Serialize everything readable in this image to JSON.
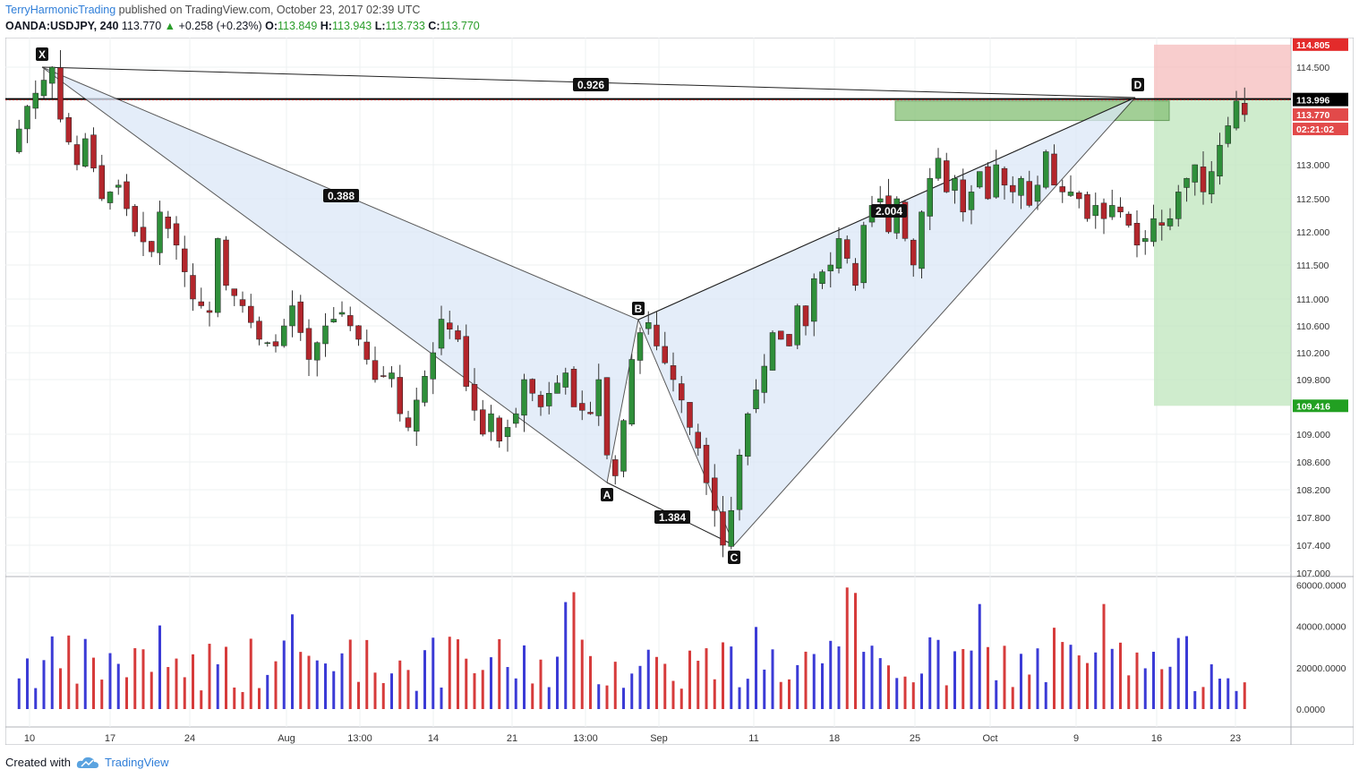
{
  "header": {
    "author": "TerryHarmonicTrading",
    "published_text": " published on TradingView.com, October 23, 2017 02:39 UTC",
    "symbol": "OANDA:USDJPY, 240",
    "last": "113.770",
    "change": "+0.258 (+0.23%)",
    "o_label": "O:",
    "o": "113.849",
    "h_label": "H:",
    "h": "113.943",
    "l_label": "L:",
    "l": "113.733",
    "c_label": "C:",
    "c": "113.770"
  },
  "footer": {
    "created_with": "Created with",
    "brand": "TradingView"
  },
  "colors": {
    "bull": "#2f8f3a",
    "bear": "#b3262c",
    "pattern_fill": "#dbe7f7",
    "stop_zone": "#f5b8b8",
    "target_zone": "#bfe6bc",
    "prz_box": "#8bc47d",
    "vol_up": "#3b3bd6",
    "vol_down": "#d63b3b"
  },
  "chart_data": {
    "type": "candlestick",
    "ylim": [
      106.9,
      114.9
    ],
    "price_ticks": [
      "114.500",
      "113.000",
      "112.500",
      "112.000",
      "111.500",
      "111.000",
      "110.600",
      "110.200",
      "109.800",
      "109.000",
      "108.600",
      "108.200",
      "107.800",
      "107.400",
      "107.000"
    ],
    "x_ticks": [
      "10",
      "17",
      "24",
      "Aug",
      "13:00",
      "14",
      "21",
      "13:00",
      "Sep",
      "11",
      "18",
      "25",
      "Oct",
      "9",
      "16",
      "23"
    ],
    "harmonic_points": [
      {
        "label": "X",
        "price": 114.5
      },
      {
        "label": "A",
        "price": 108.3
      },
      {
        "label": "B",
        "price": 110.67
      },
      {
        "label": "C",
        "price": 107.35
      },
      {
        "label": "D",
        "price": 114.01
      }
    ],
    "ratios": [
      {
        "text": "0.926",
        "between": "X-D"
      },
      {
        "text": "0.388",
        "between": "X-B"
      },
      {
        "text": "1.384",
        "between": "A-C"
      },
      {
        "text": "2.004",
        "between": "B-D"
      }
    ],
    "levels": [
      {
        "price": 114.805,
        "label": "114.805",
        "color": "#e32b2b"
      },
      {
        "price": 114.009,
        "label": "114.009",
        "color": "#000000"
      },
      {
        "price": 113.996,
        "label": "113.996",
        "color": "#000000"
      },
      {
        "price": 113.77,
        "label": "113.770",
        "color": "#e24a4a"
      },
      {
        "price": 109.416,
        "label": "109.416",
        "color": "#22a022"
      }
    ],
    "countdown": "02:21:02",
    "horizontal_line": 114.01,
    "prz_zone": [
      113.68,
      113.98
    ],
    "target_zone": [
      109.416,
      114.009
    ],
    "stop_zone": [
      114.009,
      114.805
    ],
    "close_series": [
      [
        0,
        113.2
      ],
      [
        2,
        113.9
      ],
      [
        4,
        114.3
      ],
      [
        5,
        114.5
      ],
      [
        6,
        113.7
      ],
      [
        8,
        113.0
      ],
      [
        9,
        113.4
      ],
      [
        11,
        112.5
      ],
      [
        13,
        112.7
      ],
      [
        15,
        112.0
      ],
      [
        17,
        111.7
      ],
      [
        18,
        112.3
      ],
      [
        20,
        111.8
      ],
      [
        22,
        111.0
      ],
      [
        24,
        110.8
      ],
      [
        25,
        111.9
      ],
      [
        26,
        111.2
      ],
      [
        28,
        110.9
      ],
      [
        30,
        110.4
      ],
      [
        32,
        110.3
      ],
      [
        34,
        110.9
      ],
      [
        36,
        110.1
      ],
      [
        38,
        110.6
      ],
      [
        40,
        110.8
      ],
      [
        42,
        110.4
      ],
      [
        44,
        109.8
      ],
      [
        46,
        109.9
      ],
      [
        47,
        109.3
      ],
      [
        48,
        109.1
      ],
      [
        49,
        109.5
      ],
      [
        51,
        110.2
      ],
      [
        52,
        110.7
      ],
      [
        54,
        110.4
      ],
      [
        55,
        109.7
      ],
      [
        57,
        109.0
      ],
      [
        58,
        109.3
      ],
      [
        59,
        108.9
      ],
      [
        61,
        109.3
      ],
      [
        62,
        109.8
      ],
      [
        64,
        109.4
      ],
      [
        65,
        109.6
      ],
      [
        67,
        109.9
      ],
      [
        68,
        109.4
      ],
      [
        70,
        109.3
      ],
      [
        71,
        109.8
      ],
      [
        72,
        108.7
      ],
      [
        73,
        108.4
      ],
      [
        74,
        109.2
      ],
      [
        75,
        110.1
      ],
      [
        76,
        110.5
      ],
      [
        77,
        110.65
      ],
      [
        78,
        110.3
      ],
      [
        80,
        109.8
      ],
      [
        81,
        109.5
      ],
      [
        82,
        109.1
      ],
      [
        83,
        108.8
      ],
      [
        84,
        108.3
      ],
      [
        85,
        107.9
      ],
      [
        86,
        107.4
      ],
      [
        87,
        107.9
      ],
      [
        88,
        108.7
      ],
      [
        89,
        109.3
      ],
      [
        91,
        110.0
      ],
      [
        92,
        110.5
      ],
      [
        94,
        110.3
      ],
      [
        95,
        110.9
      ],
      [
        96,
        110.6
      ],
      [
        97,
        111.3
      ],
      [
        99,
        111.5
      ],
      [
        100,
        111.9
      ],
      [
        101,
        111.6
      ],
      [
        102,
        111.2
      ],
      [
        103,
        112.1
      ],
      [
        104,
        112.4
      ],
      [
        105,
        112.5
      ],
      [
        106,
        112.0
      ],
      [
        107,
        112.5
      ],
      [
        108,
        111.9
      ],
      [
        109,
        111.5
      ],
      [
        110,
        112.3
      ],
      [
        111,
        112.8
      ],
      [
        112,
        113.1
      ],
      [
        113,
        112.6
      ],
      [
        114,
        112.8
      ],
      [
        115,
        112.3
      ],
      [
        116,
        112.6
      ],
      [
        117,
        112.9
      ],
      [
        118,
        112.5
      ],
      [
        119,
        113.0
      ],
      [
        120,
        112.7
      ],
      [
        121,
        112.6
      ],
      [
        122,
        112.8
      ],
      [
        123,
        112.4
      ],
      [
        124,
        112.7
      ],
      [
        125,
        113.2
      ],
      [
        126,
        112.7
      ],
      [
        127,
        112.6
      ],
      [
        128,
        112.6
      ],
      [
        129,
        112.5
      ],
      [
        130,
        112.2
      ],
      [
        131,
        112.4
      ],
      [
        132,
        112.2
      ],
      [
        133,
        112.4
      ],
      [
        134,
        112.3
      ],
      [
        135,
        112.1
      ],
      [
        136,
        111.8
      ],
      [
        137,
        111.9
      ],
      [
        138,
        112.2
      ],
      [
        139,
        112.1
      ],
      [
        140,
        112.2
      ],
      [
        141,
        112.6
      ],
      [
        142,
        112.8
      ],
      [
        143,
        113.0
      ],
      [
        144,
        112.6
      ],
      [
        145,
        112.9
      ],
      [
        146,
        113.3
      ],
      [
        147,
        113.6
      ],
      [
        148,
        113.98
      ],
      [
        149,
        113.77
      ]
    ],
    "volume_axis_ticks": [
      "60000.0000",
      "40000.0000",
      "20000.0000",
      "0.0000"
    ]
  }
}
